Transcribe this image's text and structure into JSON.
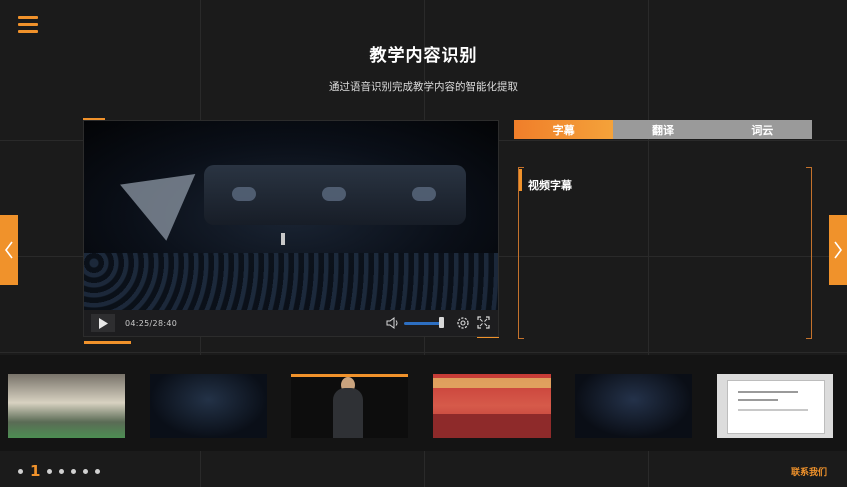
{
  "header": {
    "title": "教学内容识别",
    "subtitle": "通过语音识别完成教学内容的智能化提取"
  },
  "player": {
    "time_display": "04:25/28:40",
    "volume_level": 0.85
  },
  "tabs": [
    {
      "label": "字幕",
      "active": true
    },
    {
      "label": "翻译",
      "active": false
    },
    {
      "label": "词云",
      "active": false
    }
  ],
  "subtitle_panel": {
    "label": "视频字幕"
  },
  "pager": {
    "current_page": "1",
    "other_pages": 5
  },
  "footer": {
    "contact_label": "联系我们"
  },
  "colors": {
    "accent": "#f0922b",
    "background": "#1b1b1b",
    "tab_inactive": "#9a9a9a",
    "volume_track": "#2d6fc2"
  },
  "icons": [
    "menu-icon",
    "chevron-left-icon",
    "chevron-right-icon",
    "play-icon",
    "volume-icon",
    "settings-icon",
    "fullscreen-icon"
  ]
}
